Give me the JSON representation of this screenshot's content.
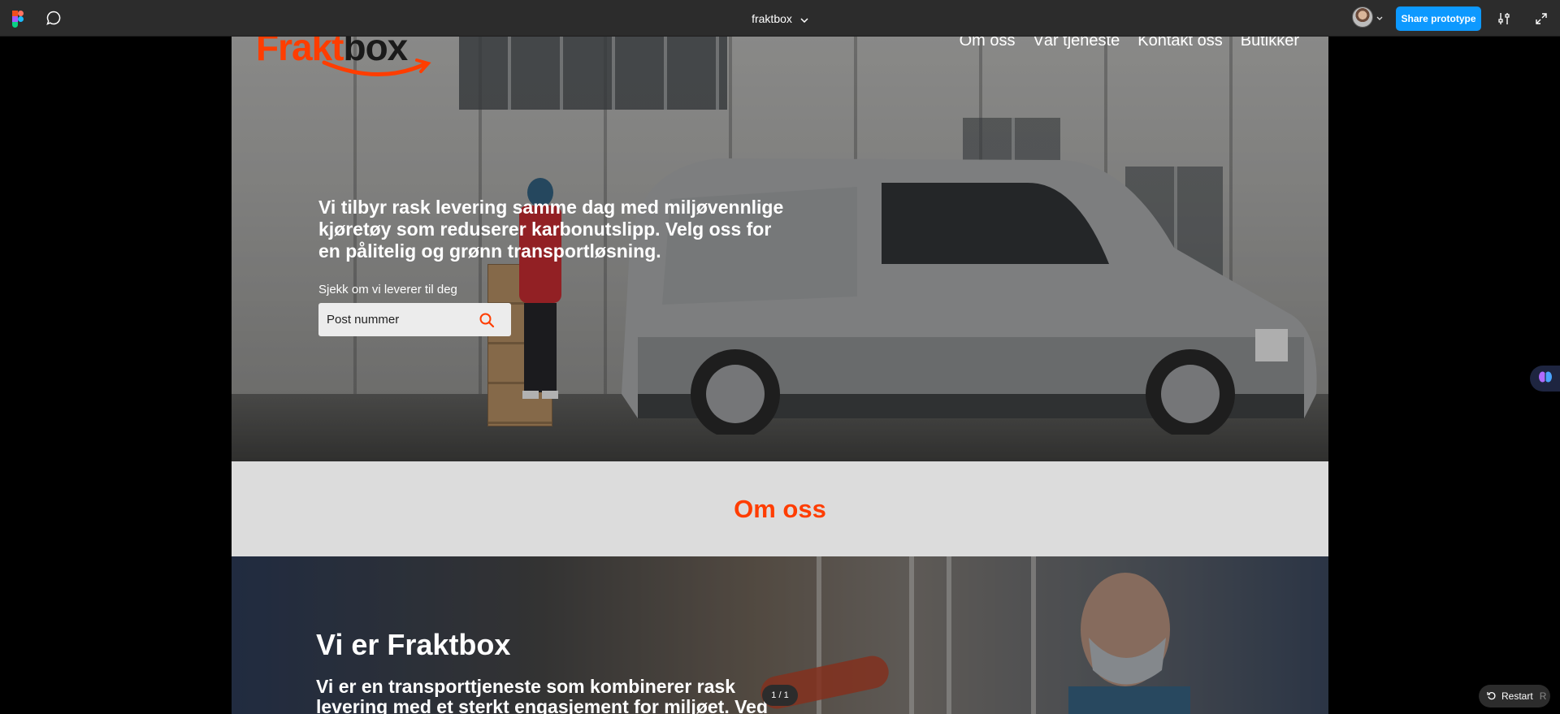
{
  "toolbar": {
    "file_name": "fraktbox",
    "share_label": "Share prototype"
  },
  "site": {
    "logo": {
      "part_a": "Frakt",
      "part_b": "box"
    },
    "nav": [
      {
        "label": "Om oss"
      },
      {
        "label": "Vår tjeneste"
      },
      {
        "label": "Kontakt oss"
      },
      {
        "label": "Butikker"
      }
    ],
    "hero": {
      "text": "Vi tilbyr rask levering samme dag med miljøvennlige kjøretøy som reduserer karbonutslipp. Velg oss for en pålitelig og grønn transportløsning.",
      "check_label": "Sjekk om vi leverer til deg",
      "search_placeholder": "Post nummer"
    },
    "about_heading": "Om oss",
    "second": {
      "title": "Vi er Fraktbox",
      "text": "Vi er en transporttjeneste som kombinerer rask levering med et sterkt engasjement for miljøet. Ved"
    }
  },
  "overlays": {
    "page_counter": "1 / 1",
    "restart_label": "Restart",
    "restart_key": "R"
  },
  "colors": {
    "accent": "#ff3d00",
    "share_button": "#0d99ff",
    "toolbar": "#2c2c2c"
  }
}
